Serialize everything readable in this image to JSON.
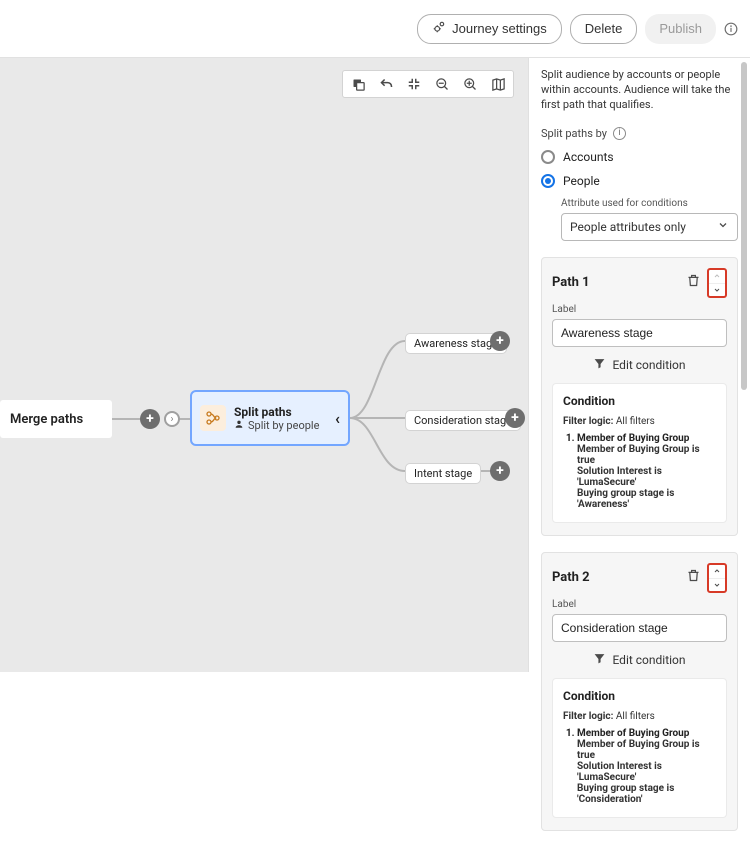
{
  "topbar": {
    "settings_label": "Journey settings",
    "delete_label": "Delete",
    "publish_label": "Publish"
  },
  "canvas": {
    "merge_label": "Merge paths",
    "split_node": {
      "title": "Split paths",
      "subtitle": "Split by people"
    },
    "stages": [
      "Awareness stage",
      "Consideration stage",
      "Intent stage"
    ]
  },
  "panel": {
    "description": "Split audience by accounts or people within accounts. Audience will take the first path that qualifies.",
    "split_by_label": "Split paths by",
    "options": {
      "accounts": "Accounts",
      "people": "People"
    },
    "selected": "people",
    "attr_label": "Attribute used for conditions",
    "attr_value": "People attributes only",
    "paths": [
      {
        "title": "Path 1",
        "label_caption": "Label",
        "label_value": "Awareness stage",
        "edit": "Edit condition",
        "arrows": {
          "up_disabled": true,
          "down_disabled": false
        },
        "condition": {
          "heading": "Condition",
          "filter_logic_label": "Filter logic:",
          "filter_logic_value": "All filters",
          "rule_head": "Member of Buying Group",
          "lines": [
            {
              "label": "Member of Buying Group",
              "value": "is true"
            },
            {
              "label": "Solution Interest",
              "value": "is 'LumaSecure'"
            },
            {
              "label": "Buying group stage",
              "value": "is 'Awareness'"
            }
          ]
        }
      },
      {
        "title": "Path 2",
        "label_caption": "Label",
        "label_value": "Consideration stage",
        "edit": "Edit condition",
        "arrows": {
          "up_disabled": false,
          "down_disabled": false
        },
        "condition": {
          "heading": "Condition",
          "filter_logic_label": "Filter logic:",
          "filter_logic_value": "All filters",
          "rule_head": "Member of Buying Group",
          "lines": [
            {
              "label": "Member of Buying Group",
              "value": "is true"
            },
            {
              "label": "Solution Interest",
              "value": "is 'LumaSecure'"
            },
            {
              "label": "Buying group stage",
              "value": "is 'Consideration'"
            }
          ]
        }
      }
    ]
  }
}
